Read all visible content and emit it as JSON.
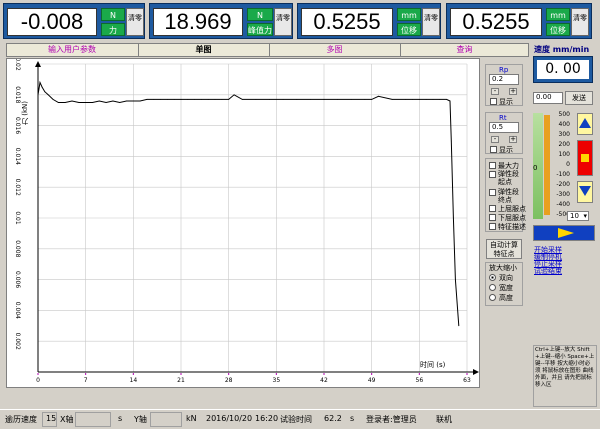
{
  "readouts": [
    {
      "value": "-0.008",
      "unit_top": "N",
      "unit_bottom": "力",
      "zero_label": "清零"
    },
    {
      "value": "18.969",
      "unit_top": "N",
      "unit_bottom": "峰值力",
      "zero_label": "清零"
    },
    {
      "value": "0.5255",
      "unit_top": "mm",
      "unit_bottom": "位移",
      "zero_label": "清零"
    },
    {
      "value": "0.5255",
      "unit_top": "mm",
      "unit_bottom": "位移",
      "zero_label": "清零"
    }
  ],
  "tabs": [
    "输入用户参数",
    "单图",
    "多图",
    "查询"
  ],
  "chart_data": {
    "type": "line",
    "ylabel": "力 (kN)",
    "xlabel": "时间 (s)",
    "xlim": [
      0,
      63
    ],
    "ylim": [
      0,
      0.02
    ],
    "x_ticks": [
      "0",
      "7",
      "14",
      "21",
      "28",
      "35",
      "42",
      "49",
      "56",
      "63"
    ],
    "y_ticks": [
      "0.02",
      "0.018",
      "0.016",
      "0.014",
      "0.012",
      "0.01",
      "0.008",
      "0.006",
      "0.004",
      "0.002"
    ],
    "series": [
      {
        "x": [
          0,
          0.3,
          0.6,
          1.0,
          1.5,
          2.2,
          3,
          4,
          5,
          6,
          7,
          8,
          9,
          10,
          11,
          12,
          13,
          14,
          15,
          16,
          17,
          18,
          19,
          20,
          21,
          22,
          23,
          24,
          25,
          26,
          27,
          28,
          28.8,
          30,
          32,
          34,
          36,
          38,
          40,
          42,
          44,
          46,
          48,
          49,
          50,
          52,
          54,
          55,
          56,
          57,
          58,
          59,
          60,
          60.5,
          60.7,
          61,
          61.3,
          61.8
        ],
        "y": [
          0.018,
          0.0188,
          0.0185,
          0.0182,
          0.018,
          0.0177,
          0.0175,
          0.0175,
          0.0176,
          0.0175,
          0.0175,
          0.0175,
          0.0176,
          0.0175,
          0.0176,
          0.0175,
          0.0176,
          0.0176,
          0.0176,
          0.0177,
          0.0177,
          0.0177,
          0.0177,
          0.0177,
          0.0177,
          0.0177,
          0.0177,
          0.0177,
          0.0177,
          0.0177,
          0.0177,
          0.0177,
          0.018,
          0.0177,
          0.0177,
          0.0177,
          0.0177,
          0.0177,
          0.0177,
          0.0177,
          0.0177,
          0.0177,
          0.0177,
          0.0177,
          0.0179,
          0.0177,
          0.0177,
          0.0177,
          0.0177,
          0.0177,
          0.0177,
          0.0177,
          0.0177,
          0.0176,
          0.015,
          0.01,
          0.006,
          0.003
        ]
      }
    ],
    "grid": true
  },
  "side": {
    "rp_title": "Rp",
    "rp_value": "0.2",
    "rt_title": "Rt",
    "rt_value": "0.5",
    "show_label": "显示",
    "checks": [
      "最大力",
      "弹性段起点",
      "弹性段终点",
      "上屈服点",
      "下屈服点",
      "特征描述"
    ],
    "calc_button": "自动计算特征点",
    "zoom_title": "放大缩小",
    "zoom_options": [
      "双向",
      "宽度",
      "高度"
    ]
  },
  "right": {
    "speed_label": "速度 mm/min",
    "speed_value": "0. 00",
    "speed_input": "0.00",
    "send_label": "发送",
    "scale": [
      "500",
      "400",
      "300",
      "200",
      "100",
      "0",
      "-100",
      "-200",
      "-300",
      "-400",
      "-500"
    ],
    "step_value": "10",
    "links": [
      "开始采样",
      "缓制停机",
      "停止采样",
      "试验结束"
    ],
    "help": "Ctrl+上键--放大 Shift+上键--缩小 Space+上键--平移 按大缩小时必须 将鼠标放在图形 曲线外面，并且 请先把鼠标移入区"
  },
  "status": {
    "history_speed_label": "逾历速度",
    "history_speed_value": "15",
    "x_axis_label": "X轴",
    "x_unit": "s",
    "y_axis_label": "Y轴",
    "y_unit": "kN",
    "date": "2016/10/20",
    "time": "16:20",
    "test_time_label": "试验时间",
    "test_time_value": "62.2",
    "test_time_unit": "s",
    "user_label": "登录者:管理员",
    "online": "联机"
  },
  "colors": {
    "accent": "#1e5aa0",
    "unit_green": "#1aa94a",
    "tab_text": "#b000b0",
    "link_blue": "#0000cc"
  }
}
